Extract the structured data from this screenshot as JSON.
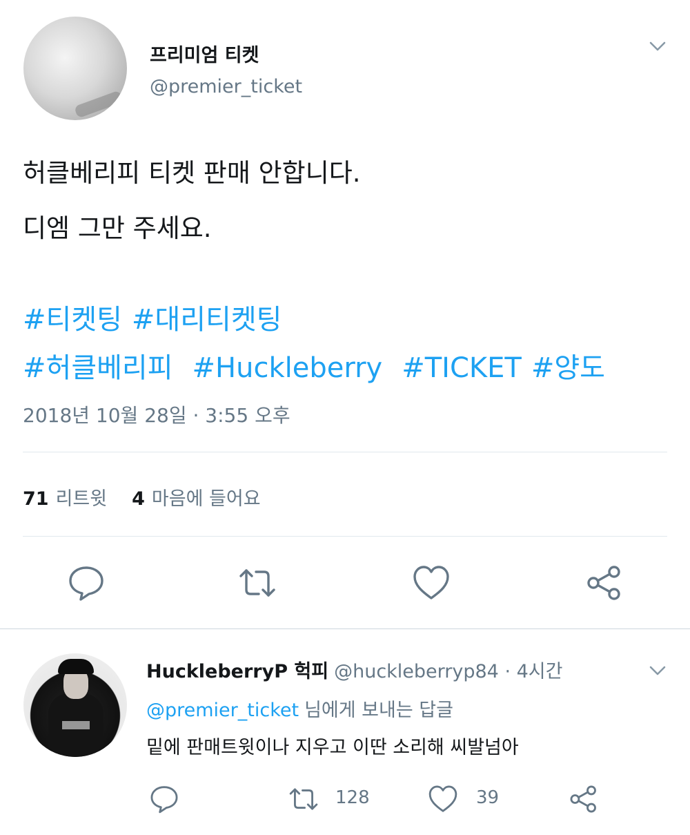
{
  "tweet": {
    "display_name": "프리미엄 티켓",
    "handle": "@premier_ticket",
    "text_lines": [
      "허클베리피 티켓 판매 안합니다.",
      "디엠 그만 주세요."
    ],
    "hashtags_row1": [
      "#티켓팅",
      "#대리티켓팅"
    ],
    "hashtags_row2": [
      "#허클베리피",
      "#Huckleberry",
      "#TICKET",
      "#양도"
    ],
    "timestamp": "2018년 10월 28일 · 3:55 오후",
    "retweet_count": "71",
    "retweet_label": "리트윗",
    "like_count": "4",
    "like_label": "마음에 들어요"
  },
  "reply": {
    "display_name": "HuckleberryP 헉피",
    "handle": "@huckleberryp84",
    "time": "· 4시간",
    "replying_mention": "@premier_ticket",
    "replying_text": "님에게 보내는 답글",
    "body": "밑에 판매트윗이나 지우고 이딴 소리해 씨발넘아",
    "retweet_count": "128",
    "like_count": "39"
  },
  "icons": {
    "chevron": "chevron-down-icon",
    "reply": "reply-icon",
    "retweet": "retweet-icon",
    "like": "heart-icon",
    "share": "share-icon"
  },
  "colors": {
    "accent": "#1da1f2",
    "secondary_text": "#657786",
    "primary_text": "#14171a",
    "divider": "#e1e8ed"
  }
}
